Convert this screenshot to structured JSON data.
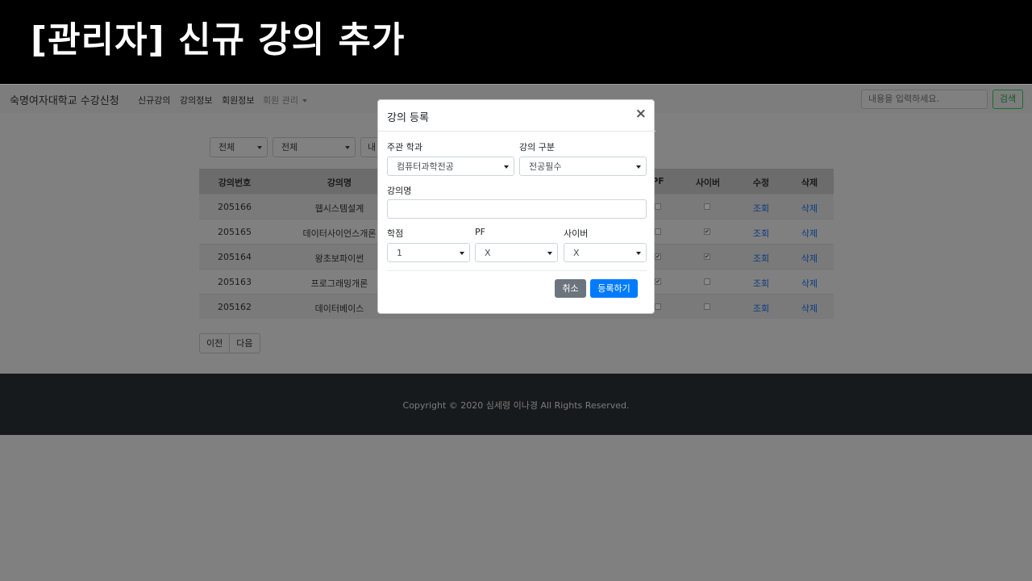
{
  "slide_title": "[관리자] 신규 강의 추가",
  "navbar": {
    "brand": "숙명여자대학교 수강신청",
    "links": [
      "신규강의",
      "강의정보",
      "회원정보"
    ],
    "dropdown_label": "회원 관리",
    "search_placeholder": "내용을 입력하세요.",
    "search_button": "검색"
  },
  "filters": {
    "first": "전체",
    "second": "전체",
    "third": "내"
  },
  "table": {
    "headers": [
      "강의번호",
      "강의명",
      "PF",
      "사이버",
      "수정",
      "삭제"
    ],
    "rows": [
      {
        "id": "205166",
        "name": "웹시스템설계",
        "pf": false,
        "cyber": false,
        "edit": "조회",
        "delete": "삭제"
      },
      {
        "id": "205165",
        "name": "데이터사이언스개론",
        "pf": false,
        "cyber": true,
        "edit": "조회",
        "delete": "삭제"
      },
      {
        "id": "205164",
        "name": "왕초보파이썬",
        "pf": true,
        "cyber": true,
        "edit": "조회",
        "delete": "삭제"
      },
      {
        "id": "205163",
        "name": "프로그래밍개론",
        "pf": true,
        "cyber": false,
        "edit": "조회",
        "delete": "삭제"
      },
      {
        "id": "205162",
        "name": "데이터베이스",
        "pf": false,
        "cyber": false,
        "edit": "조회",
        "delete": "삭제"
      }
    ]
  },
  "pager": {
    "prev": "이전",
    "next": "다음"
  },
  "footer": {
    "text": "Copyright © 2020 심세령 이나경 All Rights Reserved."
  },
  "modal": {
    "title": "강의 등록",
    "close": "×",
    "department_label": "주관 학과",
    "department_value": "컴퓨터과학전공",
    "category_label": "강의 구분",
    "category_value": "전공필수",
    "name_label": "강의명",
    "name_value": "",
    "credit_label": "학점",
    "credit_value": "1",
    "pf_label": "PF",
    "pf_value": "X",
    "cyber_label": "사이버",
    "cyber_value": "X",
    "cancel_button": "취소",
    "submit_button": "등록하기"
  },
  "colors": {
    "primary": "#007bff",
    "secondary": "#6c757d",
    "success": "#28a745",
    "footer_bg": "#343a40"
  }
}
